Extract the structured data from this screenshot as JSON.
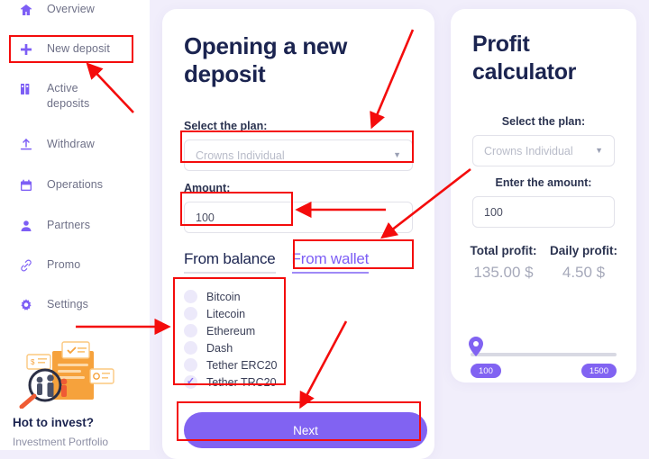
{
  "sidebar": {
    "items": [
      {
        "label": "Overview",
        "icon": "home-icon"
      },
      {
        "label": "New deposit",
        "icon": "plus-icon"
      },
      {
        "label": "Active deposits",
        "icon": "books-icon"
      },
      {
        "label": "Withdraw",
        "icon": "upload-icon"
      },
      {
        "label": "Operations",
        "icon": "calendar-icon"
      },
      {
        "label": "Partners",
        "icon": "user-icon"
      },
      {
        "label": "Promo",
        "icon": "link-icon"
      },
      {
        "label": "Settings",
        "icon": "gear-icon"
      }
    ],
    "promo": {
      "title": "Hot to invest?",
      "subtitle": "Investment Portfolio"
    }
  },
  "deposit_card": {
    "title": "Opening a new deposit",
    "plan_label": "Select the plan:",
    "plan_value": "Crowns Individual",
    "amount_label": "Amount:",
    "amount_value": "100",
    "tabs": [
      {
        "label": "From balance",
        "state": "active"
      },
      {
        "label": "From wallet",
        "state": "inactive"
      }
    ],
    "wallets": [
      {
        "label": "Bitcoin",
        "checked": false
      },
      {
        "label": "Litecoin",
        "checked": false
      },
      {
        "label": "Ethereum",
        "checked": false
      },
      {
        "label": "Dash",
        "checked": false
      },
      {
        "label": "Tether ERC20",
        "checked": false
      },
      {
        "label": "Tether TRC20",
        "checked": true
      }
    ],
    "next_label": "Next"
  },
  "calculator_card": {
    "title": "Profit calculator",
    "plan_label": "Select the plan:",
    "plan_value": "Crowns Individual",
    "amount_label": "Enter the amount:",
    "amount_value": "100",
    "total_profit_label": "Total profit:",
    "total_profit_value": "135.00 $",
    "daily_profit_label": "Daily profit:",
    "daily_profit_value": "4.50 $",
    "slider_min": "100",
    "slider_max": "1500"
  },
  "colors": {
    "accent_purple": "#8163f2",
    "navy": "#1b2450",
    "background": "#f1eefb",
    "annotation_red": "#f40c0c",
    "promo_orange": "#f5a33c"
  }
}
